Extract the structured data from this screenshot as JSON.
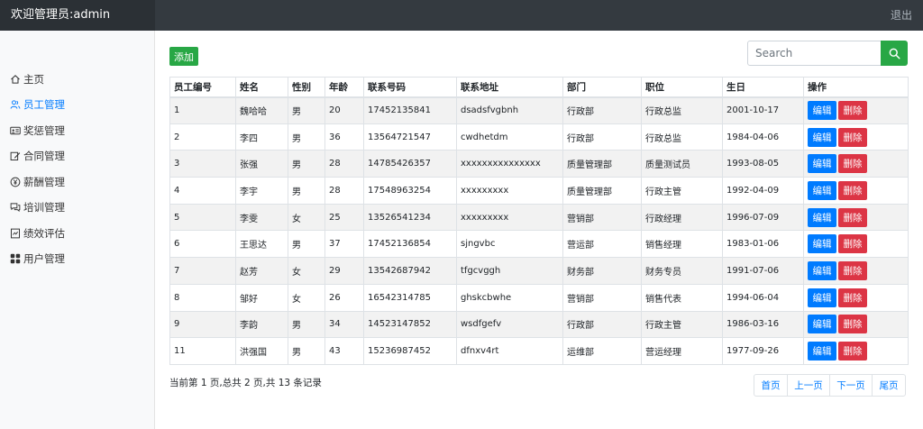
{
  "header": {
    "welcome": "欢迎管理员:admin",
    "logout": "退出"
  },
  "sidebar": {
    "items": [
      {
        "label": "主页",
        "icon": "home-icon"
      },
      {
        "label": "员工管理",
        "icon": "users-icon",
        "active": true
      },
      {
        "label": "奖惩管理",
        "icon": "card-icon"
      },
      {
        "label": "合同管理",
        "icon": "edit-icon"
      },
      {
        "label": "薪酬管理",
        "icon": "yen-icon"
      },
      {
        "label": "培训管理",
        "icon": "chat-icon"
      },
      {
        "label": "绩效评估",
        "icon": "report-icon"
      },
      {
        "label": "用户管理",
        "icon": "grid-icon"
      }
    ]
  },
  "toolbar": {
    "add_label": "添加",
    "search_placeholder": "Search"
  },
  "table": {
    "headers": [
      "员工编号",
      "姓名",
      "性别",
      "年龄",
      "联系号码",
      "联系地址",
      "部门",
      "职位",
      "生日",
      "操作"
    ],
    "edit_label": "编辑",
    "delete_label": "删除",
    "rows": [
      [
        "1",
        "魏哈哈",
        "男",
        "20",
        "17452135841",
        "dsadsfvgbnh",
        "行政部",
        "行政总监",
        "2001-10-17"
      ],
      [
        "2",
        "李四",
        "男",
        "36",
        "13564721547",
        "cwdhetdm",
        "行政部",
        "行政总监",
        "1984-04-06"
      ],
      [
        "3",
        "张强",
        "男",
        "28",
        "14785426357",
        "xxxxxxxxxxxxxxx",
        "质量管理部",
        "质量测试员",
        "1993-08-05"
      ],
      [
        "4",
        "李宇",
        "男",
        "28",
        "17548963254",
        "xxxxxxxxx",
        "质量管理部",
        "行政主管",
        "1992-04-09"
      ],
      [
        "5",
        "李雯",
        "女",
        "25",
        "13526541234",
        "xxxxxxxxx",
        "营销部",
        "行政经理",
        "1996-07-09"
      ],
      [
        "6",
        "王思达",
        "男",
        "37",
        "17452136854",
        "sjngvbc",
        "营运部",
        "销售经理",
        "1983-01-06"
      ],
      [
        "7",
        "赵芳",
        "女",
        "29",
        "13542687942",
        "tfgcvggh",
        "财务部",
        "财务专员",
        "1991-07-06"
      ],
      [
        "8",
        "邹好",
        "女",
        "26",
        "16542314785",
        "ghskcbwhe",
        "营销部",
        "销售代表",
        "1994-06-04"
      ],
      [
        "9",
        "李韵",
        "男",
        "34",
        "14523147852",
        "wsdfgefv",
        "行政部",
        "行政主管",
        "1986-03-16"
      ],
      [
        "11",
        "洪强国",
        "男",
        "43",
        "15236987452",
        "dfnxv4rt",
        "运维部",
        "营运经理",
        "1977-09-26"
      ]
    ]
  },
  "pagination": {
    "info": "当前第 1 页,总共 2 页,共 13 条记录",
    "first": "首页",
    "prev": "上一页",
    "next": "下一页",
    "last": "尾页"
  },
  "colors": {
    "primary": "#007bff",
    "success": "#28a745",
    "danger": "#dc3545",
    "topbar": "#343a40"
  }
}
